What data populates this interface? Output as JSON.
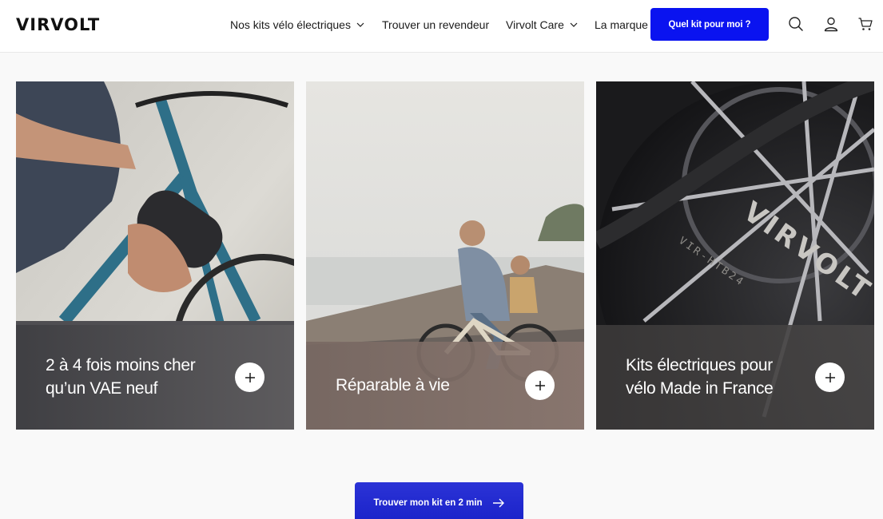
{
  "header": {
    "logo": "VIRVOLT",
    "nav": [
      {
        "label": "Nos kits vélo électriques",
        "has_dropdown": true
      },
      {
        "label": "Trouver un revendeur",
        "has_dropdown": false
      },
      {
        "label": "Virvolt Care",
        "has_dropdown": true
      },
      {
        "label": "La marque",
        "has_dropdown": false
      }
    ],
    "cta_label": "Quel kit pour moi ?",
    "icons": [
      "search-icon",
      "account-icon",
      "cart-icon"
    ]
  },
  "cards": [
    {
      "caption_line1": "2 à 4 fois moins cher",
      "caption_line2": "qu’un VAE neuf",
      "image": "hand-mounting-battery-on-bike-photo",
      "action_icon": "plus-icon"
    },
    {
      "caption_line1": "Réparable à vie",
      "caption_line2": "",
      "image": "mother-and-child-riding-bike-seaside-photo",
      "action_icon": "plus-icon"
    },
    {
      "caption_line1": "Kits électriques pour",
      "caption_line2": "vélo Made in France",
      "image": "virvolt-hub-motor-closeup-photo",
      "motor_text": "VIRVOLT",
      "motor_subtext": "VIR-HTB24",
      "action_icon": "plus-icon"
    }
  ],
  "bottom_cta": {
    "label": "Trouver mon kit en 2 min",
    "icon": "arrow-right-icon"
  },
  "colors": {
    "accent": "#0a13f0",
    "header_bg": "#ffffff",
    "page_bg": "#f9f9f9"
  }
}
